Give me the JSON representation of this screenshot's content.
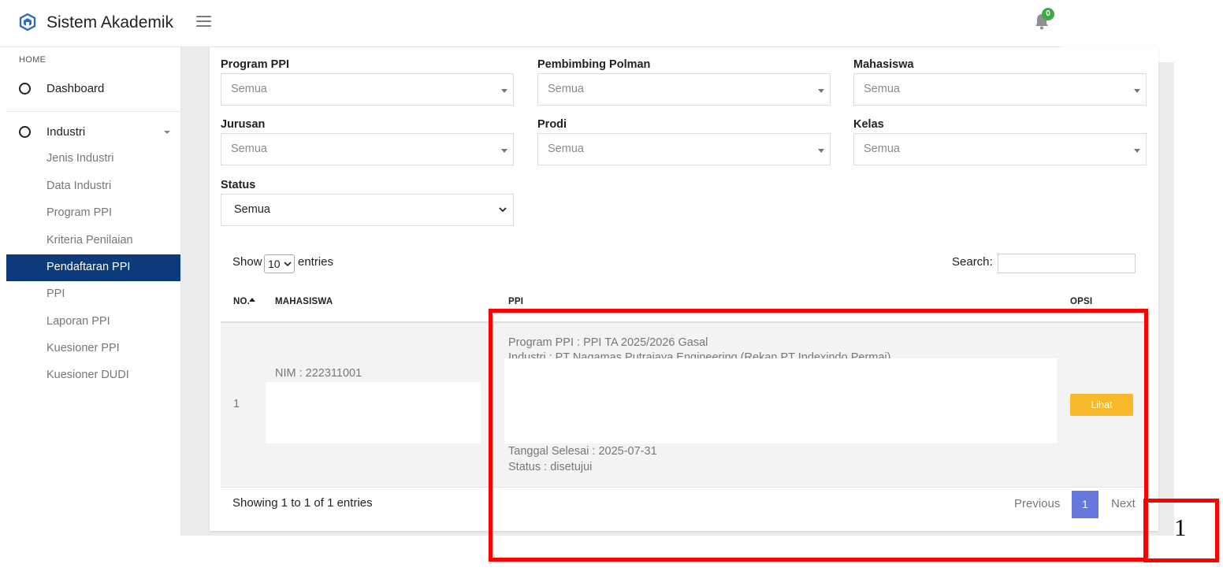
{
  "header": {
    "app_title": "Sistem Akademik",
    "notification_count": "0"
  },
  "sidebar": {
    "section_label": "HOME",
    "dashboard_label": "Dashboard",
    "industri_label": "Industri",
    "items": [
      {
        "label": "Jenis Industri"
      },
      {
        "label": "Data Industri"
      },
      {
        "label": "Program PPI"
      },
      {
        "label": "Kriteria Penilaian"
      },
      {
        "label": "Pendaftaran PPI",
        "active": true
      },
      {
        "label": "PPI"
      },
      {
        "label": "Laporan PPI"
      },
      {
        "label": "Kuesioner PPI"
      },
      {
        "label": "Kuesioner DUDI"
      }
    ]
  },
  "filters": {
    "program_ppi": {
      "label": "Program PPI",
      "value": "Semua"
    },
    "pembimbing": {
      "label": "Pembimbing Polman",
      "value": "Semua"
    },
    "mahasiswa": {
      "label": "Mahasiswa",
      "value": "Semua"
    },
    "jurusan": {
      "label": "Jurusan",
      "value": "Semua"
    },
    "prodi": {
      "label": "Prodi",
      "value": "Semua"
    },
    "kelas": {
      "label": "Kelas",
      "value": "Semua"
    },
    "status": {
      "label": "Status",
      "value": "Semua"
    }
  },
  "table": {
    "show_label": "Show",
    "length_value": "10",
    "entries_label": "entries",
    "search_label": "Search:",
    "search_value": "",
    "columns": {
      "no": "NO.",
      "mahasiswa": "MAHASISWA",
      "ppi": "PPI",
      "opsi": "OPSI"
    },
    "rows": [
      {
        "no": "1",
        "nim": "NIM : 222311001",
        "program": "Program PPI : PPI TA 2025/2026 Gasal",
        "industri": "Industri : PT Nagamas Putrajaya Engineering (Rekan PT Indexindo Permai)",
        "tanggal_selesai": "Tanggal Selesai : 2025-07-31",
        "status": "Status : disetujui",
        "action_label": "Lihat"
      }
    ],
    "info": "Showing 1 to 1 of 1 entries",
    "pagination": {
      "previous": "Previous",
      "current": "1",
      "next": "Next"
    }
  },
  "annotation": {
    "label": "1",
    "color": "#ff0000"
  }
}
